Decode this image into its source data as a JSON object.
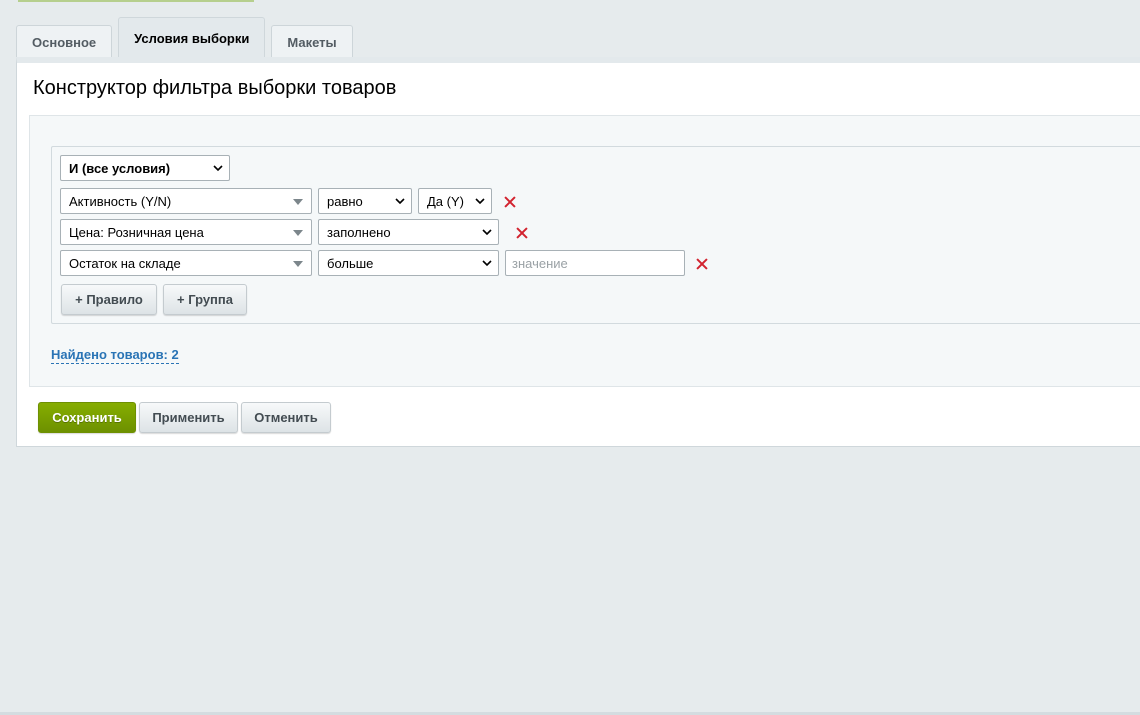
{
  "tabs": [
    {
      "label": "Основное",
      "active": false
    },
    {
      "label": "Условия выборки",
      "active": true
    },
    {
      "label": "Макеты",
      "active": false
    }
  ],
  "panel": {
    "title": "Конструктор фильтра выборки товаров"
  },
  "group": {
    "logic": "И (все условия)"
  },
  "rules": [
    {
      "field": "Активность (Y/N)",
      "operator": "равно",
      "value": "Да (Y)"
    },
    {
      "field": "Цена: Розничная цена",
      "operator": "заполнено"
    },
    {
      "field": "Остаток на складе",
      "operator": "больше",
      "value_placeholder": "значение"
    }
  ],
  "group_buttons": {
    "add_rule": "+ Правило",
    "add_group": "+ Группа"
  },
  "found": {
    "label": "Найдено товаров:",
    "count": "2"
  },
  "actions": {
    "save": "Сохранить",
    "apply": "Применить",
    "cancel": "Отменить"
  },
  "colors": {
    "accent_green": "#77a000",
    "delete_red": "#d2232f",
    "link_blue": "#2a74b5"
  }
}
